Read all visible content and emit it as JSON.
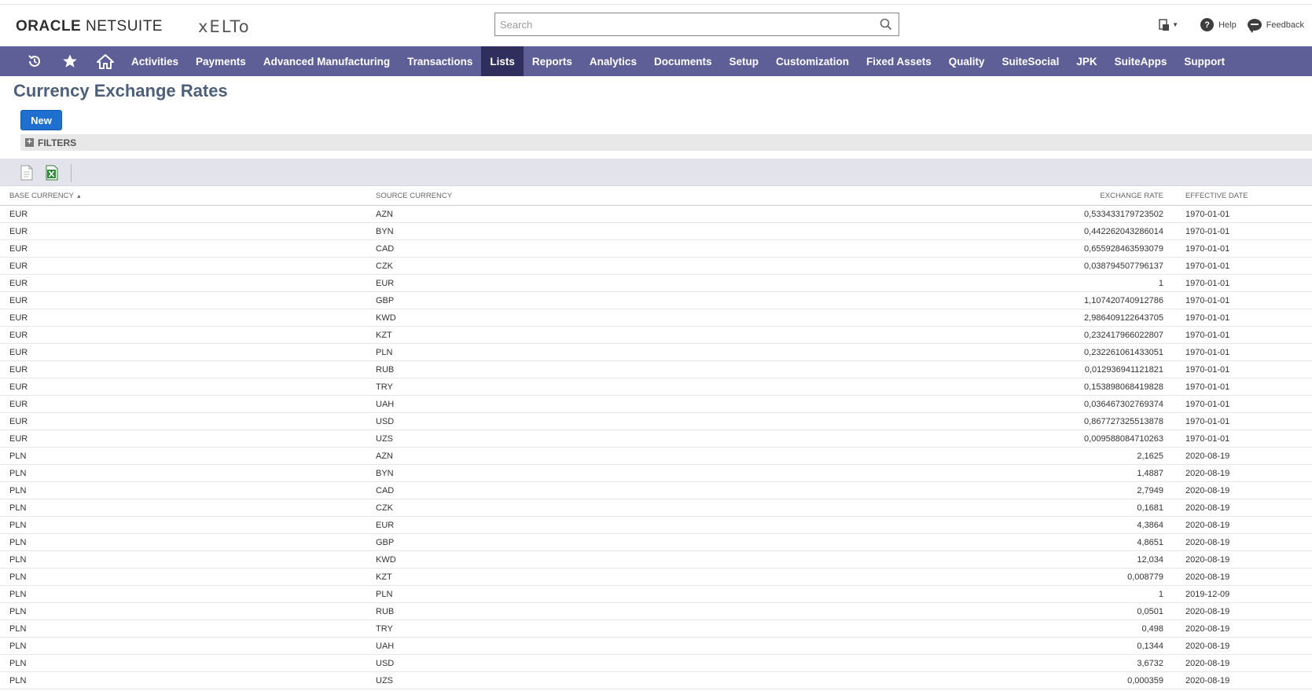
{
  "header": {
    "brand_oracle": "ORACLE",
    "brand_netsuite": "NETSUITE",
    "company_logo": "xELTo",
    "search_placeholder": "Search",
    "help_label": "Help",
    "feedback_label": "Feedback"
  },
  "nav": {
    "items": [
      "Activities",
      "Payments",
      "Advanced Manufacturing",
      "Transactions",
      "Lists",
      "Reports",
      "Analytics",
      "Documents",
      "Setup",
      "Customization",
      "Fixed Assets",
      "Quality",
      "SuiteSocial",
      "JPK",
      "SuiteApps",
      "Support"
    ],
    "active": "Lists",
    "color": "#5e5f96",
    "active_color": "#2f2e5c"
  },
  "page": {
    "title": "Currency Exchange Rates",
    "new_button": "New",
    "filters_label": "FILTERS"
  },
  "table": {
    "columns": {
      "base": "BASE CURRENCY",
      "source": "SOURCE CURRENCY",
      "rate": "EXCHANGE RATE",
      "date": "EFFECTIVE DATE"
    },
    "sort_indicator": "▲",
    "rows": [
      [
        "EUR",
        "AZN",
        "0,533433179723502",
        "1970-01-01"
      ],
      [
        "EUR",
        "BYN",
        "0,442262043286014",
        "1970-01-01"
      ],
      [
        "EUR",
        "CAD",
        "0,655928463593079",
        "1970-01-01"
      ],
      [
        "EUR",
        "CZK",
        "0,038794507796137",
        "1970-01-01"
      ],
      [
        "EUR",
        "EUR",
        "1",
        "1970-01-01"
      ],
      [
        "EUR",
        "GBP",
        "1,107420740912786",
        "1970-01-01"
      ],
      [
        "EUR",
        "KWD",
        "2,986409122643705",
        "1970-01-01"
      ],
      [
        "EUR",
        "KZT",
        "0,232417966022807",
        "1970-01-01"
      ],
      [
        "EUR",
        "PLN",
        "0,232261061433051",
        "1970-01-01"
      ],
      [
        "EUR",
        "RUB",
        "0,012936941121821",
        "1970-01-01"
      ],
      [
        "EUR",
        "TRY",
        "0,153898068419828",
        "1970-01-01"
      ],
      [
        "EUR",
        "UAH",
        "0,036467302769374",
        "1970-01-01"
      ],
      [
        "EUR",
        "USD",
        "0,867727325513878",
        "1970-01-01"
      ],
      [
        "EUR",
        "UZS",
        "0,009588084710263",
        "1970-01-01"
      ],
      [
        "PLN",
        "AZN",
        "2,1625",
        "2020-08-19"
      ],
      [
        "PLN",
        "BYN",
        "1,4887",
        "2020-08-19"
      ],
      [
        "PLN",
        "CAD",
        "2,7949",
        "2020-08-19"
      ],
      [
        "PLN",
        "CZK",
        "0,1681",
        "2020-08-19"
      ],
      [
        "PLN",
        "EUR",
        "4,3864",
        "2020-08-19"
      ],
      [
        "PLN",
        "GBP",
        "4,8651",
        "2020-08-19"
      ],
      [
        "PLN",
        "KWD",
        "12,034",
        "2020-08-19"
      ],
      [
        "PLN",
        "KZT",
        "0,008779",
        "2020-08-19"
      ],
      [
        "PLN",
        "PLN",
        "1",
        "2019-12-09"
      ],
      [
        "PLN",
        "RUB",
        "0,0501",
        "2020-08-19"
      ],
      [
        "PLN",
        "TRY",
        "0,498",
        "2020-08-19"
      ],
      [
        "PLN",
        "UAH",
        "0,1344",
        "2020-08-19"
      ],
      [
        "PLN",
        "USD",
        "3,6732",
        "2020-08-19"
      ],
      [
        "PLN",
        "UZS",
        "0,000359",
        "2020-08-19"
      ]
    ]
  }
}
